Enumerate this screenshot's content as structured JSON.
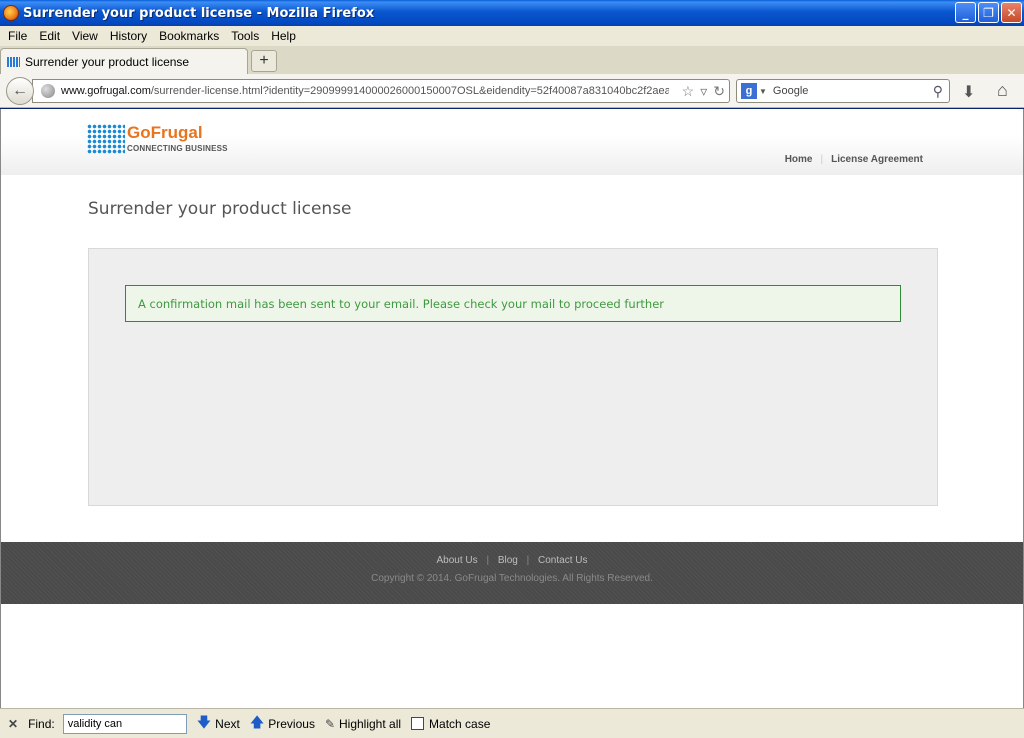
{
  "window": {
    "title": "Surrender your product license - Mozilla Firefox"
  },
  "menubar": [
    "File",
    "Edit",
    "View",
    "History",
    "Bookmarks",
    "Tools",
    "Help"
  ],
  "tab": {
    "label": "Surrender your product license",
    "new_tab_label": "+"
  },
  "nav": {
    "url_domain": "www.gofrugal.com",
    "url_path": "/surrender-license.html?identity=290999914000026000150007OSL&eidendity=52f40087a831040bc2f2aea(",
    "search_placeholder": "Google"
  },
  "site": {
    "logo_name": "GoFrugal",
    "logo_tagline": "CONNECTING BUSINESS",
    "topnav": [
      "Home",
      "License Agreement"
    ],
    "page_title": "Surrender your product license",
    "alert_message": "A confirmation mail has been sent to your email. Please check your mail to proceed further",
    "footer_links": [
      "About Us",
      "Blog",
      "Contact Us"
    ],
    "copyright": "Copyright © 2014. GoFrugal Technologies. All Rights Reserved."
  },
  "findbar": {
    "label": "Find:",
    "query": "validity can",
    "next_label": "Next",
    "previous_label": "Previous",
    "highlight_label": "Highlight all",
    "match_case_label": "Match case"
  },
  "colors": {
    "brand_orange": "#e8741e",
    "brand_blue": "#1a8ad4",
    "alert_green": "#3f9a3f"
  }
}
